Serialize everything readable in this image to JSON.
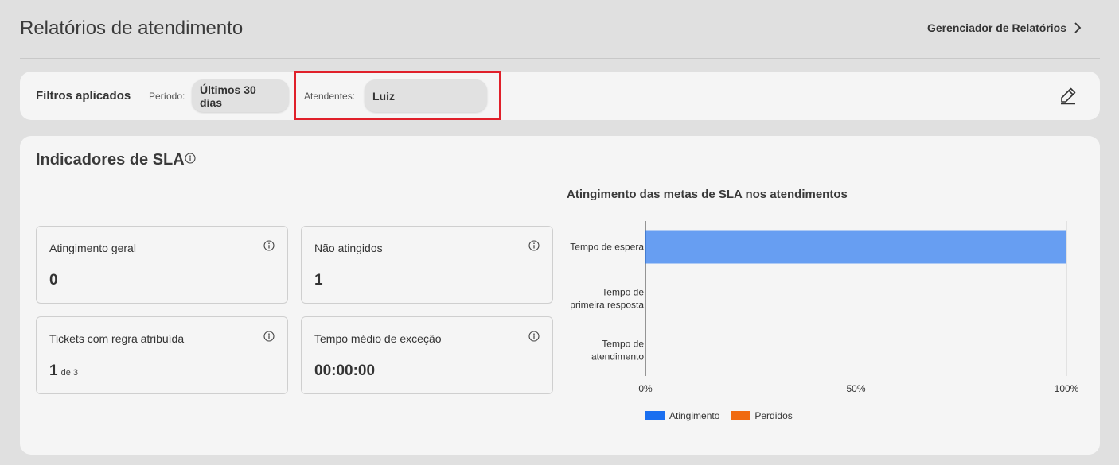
{
  "header": {
    "title": "Relatórios de atendimento",
    "manager_link": "Gerenciador de Relatórios"
  },
  "filters": {
    "title": "Filtros aplicados",
    "period_label": "Período:",
    "period_value": "Últimos 30 dias",
    "agents_label": "Atendentes:",
    "agents_value": "Luiz",
    "edit_icon": "pencil-icon"
  },
  "sla": {
    "title": "Indicadores de SLA",
    "metrics": [
      {
        "label": "Atingimento geral",
        "value": "0",
        "sub": ""
      },
      {
        "label": "Não atingidos",
        "value": "1",
        "sub": ""
      },
      {
        "label": "Tickets com regra atribuída",
        "value": "1",
        "sub": "de 3"
      },
      {
        "label": "Tempo médio de exceção",
        "value": "00:00:00",
        "sub": ""
      }
    ]
  },
  "chart_data": {
    "type": "bar",
    "orientation": "horizontal",
    "stacked": true,
    "title": "Atingimento das metas de SLA nos atendimentos",
    "categories": [
      "Tempo de espera",
      "Tempo de primeira resposta",
      "Tempo de atendimento"
    ],
    "category_lines": [
      [
        "Tempo de espera"
      ],
      [
        "Tempo de",
        "primeira resposta"
      ],
      [
        "Tempo de",
        "atendimento"
      ]
    ],
    "series": [
      {
        "name": "Atingimento",
        "values": [
          100,
          0,
          0
        ],
        "color": "#1a6ff0"
      },
      {
        "name": "Perdidos",
        "values": [
          0,
          0,
          0
        ],
        "color": "#f06a10"
      }
    ],
    "xlim": [
      0,
      100
    ],
    "x_ticks": [
      "0%",
      "50%",
      "100%"
    ],
    "grid": true,
    "legend_position": "bottom"
  }
}
